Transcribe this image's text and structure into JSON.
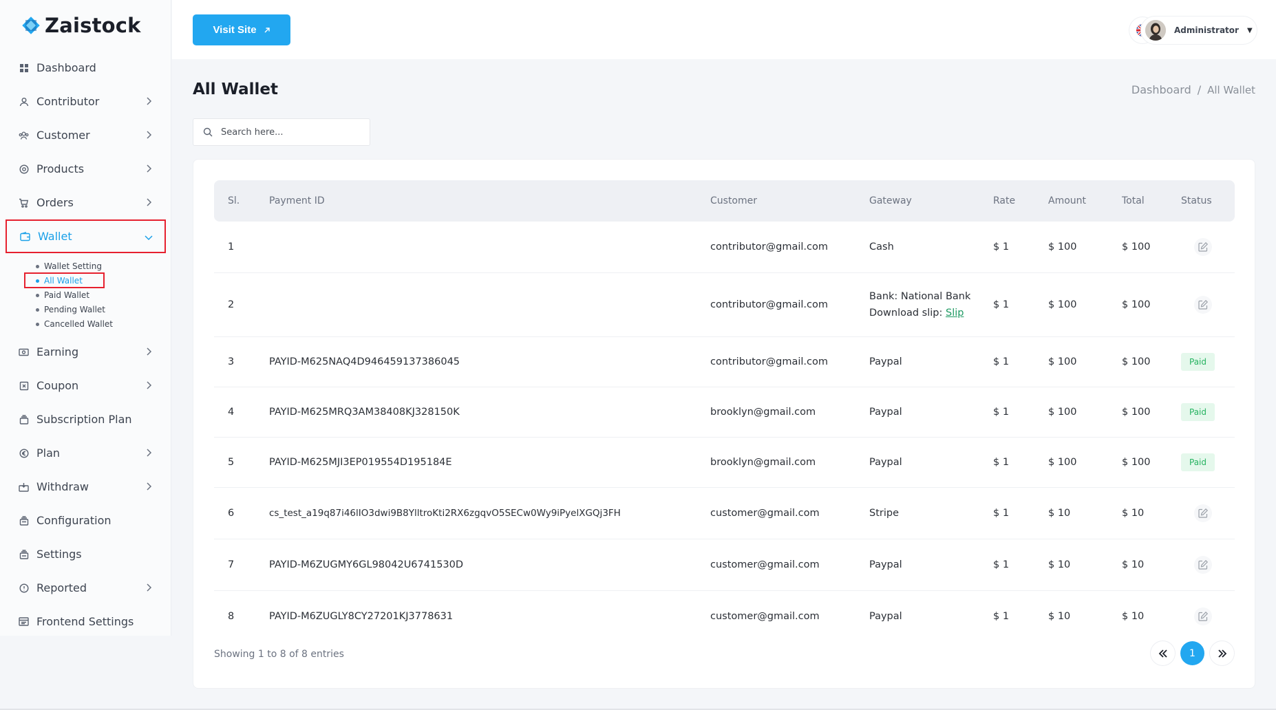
{
  "brand": {
    "name": "Zaistock",
    "accent": "#22a7f0",
    "highlight": "#e6202e"
  },
  "sidebar": {
    "items": [
      {
        "label": "Dashboard",
        "icon": "grid-icon",
        "chevron": false
      },
      {
        "label": "Contributor",
        "icon": "user-icon",
        "chevron": true
      },
      {
        "label": "Customer",
        "icon": "users-icon",
        "chevron": true
      },
      {
        "label": "Products",
        "icon": "box-icon",
        "chevron": true
      },
      {
        "label": "Orders",
        "icon": "cart-icon",
        "chevron": true
      },
      {
        "label": "Wallet",
        "icon": "wallet-icon",
        "chevron": true,
        "active": true
      },
      {
        "label": "Earning",
        "icon": "cash-icon",
        "chevron": true
      },
      {
        "label": "Coupon",
        "icon": "ticket-icon",
        "chevron": true
      },
      {
        "label": "Subscription Plan",
        "icon": "layers-icon",
        "chevron": false
      },
      {
        "label": "Plan",
        "icon": "euro-icon",
        "chevron": true
      },
      {
        "label": "Withdraw",
        "icon": "withdraw-icon",
        "chevron": true
      },
      {
        "label": "Configuration",
        "icon": "config-icon",
        "chevron": false
      },
      {
        "label": "Settings",
        "icon": "settings-icon",
        "chevron": false
      },
      {
        "label": "Reported",
        "icon": "info-icon",
        "chevron": true
      },
      {
        "label": "Frontend Settings",
        "icon": "frontend-icon",
        "chevron": false
      }
    ],
    "wallet_sub": [
      "Wallet Setting",
      "All Wallet",
      "Paid Wallet",
      "Pending Wallet",
      "Cancelled Wallet"
    ],
    "wallet_sub_active": "All Wallet"
  },
  "topbar": {
    "visit_label": "Visit Site",
    "visit_icon": "external-link-icon",
    "lang_icon": "uk-flag-icon",
    "user_name": "Administrator"
  },
  "page": {
    "title": "All Wallet",
    "breadcrumb_root": "Dashboard",
    "breadcrumb_sep": "/",
    "breadcrumb_current": "All Wallet"
  },
  "search": {
    "placeholder": "Search here..."
  },
  "table": {
    "headers": [
      "Sl.",
      "Payment ID",
      "Customer",
      "Gateway",
      "Rate",
      "Amount",
      "Total",
      "Status"
    ],
    "rows": [
      {
        "sl": "1",
        "payment_id": "",
        "customer": "contributor@gmail.com",
        "gateway": "Cash",
        "rate": "$ 1",
        "amount": "$ 100",
        "total": "$ 100",
        "status": "edit"
      },
      {
        "sl": "2",
        "payment_id": "",
        "customer": "contributor@gmail.com",
        "gateway": "Bank: National Bank",
        "gateway_line2": "Download slip:",
        "gateway_link": "Slip",
        "rate": "$ 1",
        "amount": "$ 100",
        "total": "$ 100",
        "status": "edit"
      },
      {
        "sl": "3",
        "payment_id": "PAYID-M625NAQ4D946459137386045",
        "customer": "contributor@gmail.com",
        "gateway": "Paypal",
        "rate": "$ 1",
        "amount": "$ 100",
        "total": "$ 100",
        "status": "Paid"
      },
      {
        "sl": "4",
        "payment_id": "PAYID-M625MRQ3AM38408KJ328150K",
        "customer": "brooklyn@gmail.com",
        "gateway": "Paypal",
        "rate": "$ 1",
        "amount": "$ 100",
        "total": "$ 100",
        "status": "Paid"
      },
      {
        "sl": "5",
        "payment_id": "PAYID-M625MJI3EP019554D195184E",
        "customer": "brooklyn@gmail.com",
        "gateway": "Paypal",
        "rate": "$ 1",
        "amount": "$ 100",
        "total": "$ 100",
        "status": "Paid"
      },
      {
        "sl": "6",
        "payment_id": "cs_test_a19q87i46lIO3dwi9B8YlltroKti2RX6zgqvO5SECw0Wy9iPyelXGQj3FH",
        "customer": "customer@gmail.com",
        "gateway": "Stripe",
        "rate": "$ 1",
        "amount": "$ 10",
        "total": "$ 10",
        "status": "edit"
      },
      {
        "sl": "7",
        "payment_id": "PAYID-M6ZUGMY6GL98042U6741530D",
        "customer": "customer@gmail.com",
        "gateway": "Paypal",
        "rate": "$ 1",
        "amount": "$ 10",
        "total": "$ 10",
        "status": "edit"
      },
      {
        "sl": "8",
        "payment_id": "PAYID-M6ZUGLY8CY27201KJ3778631",
        "customer": "customer@gmail.com",
        "gateway": "Paypal",
        "rate": "$ 1",
        "amount": "$ 10",
        "total": "$ 10",
        "status": "edit"
      }
    ]
  },
  "footer": {
    "showing": "Showing 1 to 8 of 8 entries",
    "prev_icon": "double-chevron-left-icon",
    "next_icon": "double-chevron-right-icon",
    "current_page": "1"
  }
}
